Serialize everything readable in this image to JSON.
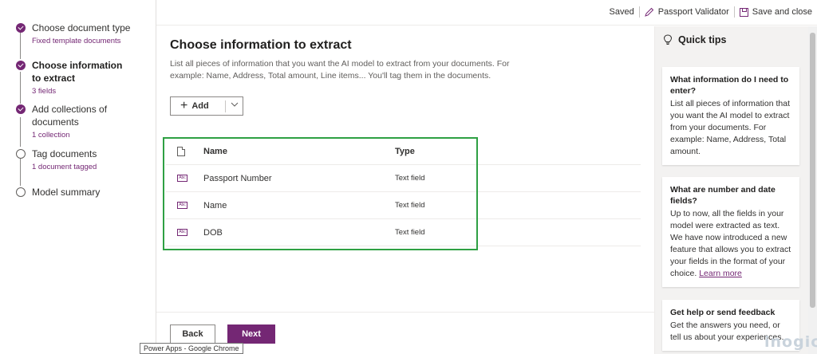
{
  "stepper": {
    "steps": [
      {
        "title": "Choose document type",
        "sub": "Fixed template documents",
        "status": "done"
      },
      {
        "title": "Choose information to extract",
        "sub": "3 fields",
        "status": "current"
      },
      {
        "title": "Add collections of documents",
        "sub": "1 collection",
        "status": "done"
      },
      {
        "title": "Tag documents",
        "sub": "1 document tagged",
        "status": "todo"
      },
      {
        "title": "Model summary",
        "sub": "",
        "status": "todo"
      }
    ]
  },
  "topbar": {
    "saved": "Saved",
    "model_name": "Passport Validator",
    "save_close": "Save and close"
  },
  "main": {
    "title": "Choose information to extract",
    "description": "List all pieces of information that you want the AI model to extract from your documents. For example: Name, Address, Total amount, Line items... You'll tag them in the documents.",
    "add_label": "Add",
    "table": {
      "col_name": "Name",
      "col_type": "Type",
      "rows": [
        {
          "name": "Passport Number",
          "type": "Text field",
          "icon": "Abc"
        },
        {
          "name": "Name",
          "type": "Text field",
          "icon": "Abc"
        },
        {
          "name": "DOB",
          "type": "Text field",
          "icon": "Abc"
        }
      ]
    },
    "back_label": "Back",
    "next_label": "Next",
    "tooltip": "Power Apps - Google Chrome"
  },
  "tips": {
    "header": "Quick tips",
    "cards": [
      {
        "title": "What information do I need to enter?",
        "body": "List all pieces of information that you want the AI model to extract from your documents. For example: Name, Address, Total amount.",
        "link": ""
      },
      {
        "title": "What are number and date fields?",
        "body": "Up to now, all the fields in your model were extracted as text. We have now introduced a new feature that allows you to extract your fields in the format of your choice.",
        "link": "Learn more"
      },
      {
        "title": "Get help or send feedback",
        "body": "Get the answers you need, or tell us about your experiences.",
        "link": ""
      }
    ]
  },
  "watermark": "inogic",
  "colors": {
    "accent": "#742774",
    "highlight_box": "#2ea043"
  }
}
